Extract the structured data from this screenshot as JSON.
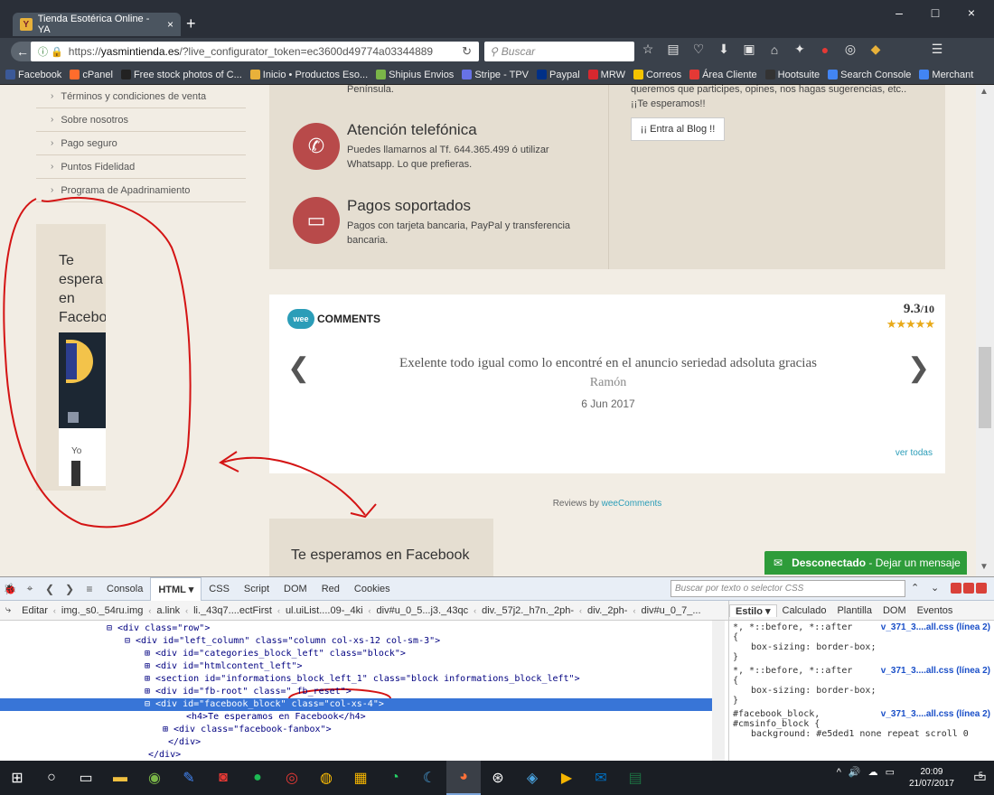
{
  "browser": {
    "tab_title": "Tienda Esotérica Online - YA",
    "tab_close": "×",
    "new_tab": "+",
    "url_prefix": "https://",
    "url_domain": "yasmintienda.es",
    "url_rest": "/?live_configurator_token=ec3600d49774a03344889",
    "search_placeholder": "Buscar",
    "minimize": "–",
    "maximize": "□",
    "close": "×",
    "bookmarks": [
      {
        "label": "Facebook",
        "color": "#3b5998"
      },
      {
        "label": "cPanel",
        "color": "#ff6c2c"
      },
      {
        "label": "Free stock photos of C...",
        "color": "#222"
      },
      {
        "label": "Inicio • Productos Eso...",
        "color": "#e8b13a"
      },
      {
        "label": "Shipius Envios",
        "color": "#7ab648"
      },
      {
        "label": "Stripe - TPV",
        "color": "#6772e5"
      },
      {
        "label": "Paypal",
        "color": "#003087"
      },
      {
        "label": "MRW",
        "color": "#d7282f"
      },
      {
        "label": "Correos",
        "color": "#f5c400"
      },
      {
        "label": "Área Cliente",
        "color": "#e53935"
      },
      {
        "label": "Hootsuite",
        "color": "#333"
      },
      {
        "label": "Search Console",
        "color": "#4285f4"
      },
      {
        "label": "Merchant",
        "color": "#4285f4"
      }
    ]
  },
  "page": {
    "menu_items": [
      "Términos y condiciones de venta",
      "Sobre nosotros",
      "Pago seguro",
      "Puntos Fidelidad",
      "Programa de Apadrinamiento"
    ],
    "fb_title": "Te\nespera\nen\nFacebo",
    "fb_yo": "Yo",
    "peninsula": "Península.",
    "phone_title": "Atención telefónica",
    "phone_text": "Puedes llamarnos al Tf. 644.365.499 ó utilizar Whatsapp. Lo que prefieras.",
    "pay_title": "Pagos soportados",
    "pay_text": "Pagos con tarjeta bancaria, PayPal y transferencia bancaria.",
    "blog_text": "queremos que participes, opines, nos hagas sugerencias, etc.. ¡¡Te esperamos!!",
    "blog_button": "¡¡ Entra al Blog !!",
    "reviews": {
      "brand_wee": "wee",
      "brand_comments": "COMMENTS",
      "score": "9.3",
      "score_max": "/10",
      "stars": "★★★★★",
      "text": "Exelente todo igual como lo encontré en el anuncio seriedad adsoluta gracias",
      "author": "Ramón",
      "date": "6 Jun 2017",
      "see_all": "ver todas",
      "prev": "❮",
      "next": "❯"
    },
    "reviews_by_prefix": "Reviews by ",
    "reviews_by_brand": "weeComments",
    "fb_bottom_title": "Te esperamos en Facebook",
    "chat_status": "Desconectado",
    "chat_action": " - Dejar un mensaje"
  },
  "devtools": {
    "tabs": [
      "Consola",
      "HTML ▾",
      "CSS",
      "Script",
      "DOM",
      "Red",
      "Cookies"
    ],
    "search_placeholder": "Buscar por texto o selector CSS",
    "edit_label": "Editar",
    "breadcrumbs": [
      "img._s0._54ru.img",
      "a.link",
      "li._43q7....ectFirst",
      "ul.uiList....09-_4ki",
      "div#u_0_5...j3._43qc",
      "div._57j2._h7n._2ph-",
      "div._2ph-",
      "div#u_0_7_..."
    ],
    "html_lines": [
      {
        "indent": 118,
        "expander": "⊟",
        "text": "<div class=\"row\">"
      },
      {
        "indent": 138,
        "expander": "⊟",
        "text": "<div id=\"left_column\" class=\"column col-xs-12 col-sm-3\">"
      },
      {
        "indent": 160,
        "expander": "⊞",
        "text": "<div id=\"categories_block_left\" class=\"block\">"
      },
      {
        "indent": 160,
        "expander": "⊞",
        "text": "<div id=\"htmlcontent_left\">"
      },
      {
        "indent": 160,
        "expander": "⊞",
        "text": "<section id=\"informations_block_left_1\" class=\"block informations_block_left\">"
      },
      {
        "indent": 160,
        "expander": "⊞",
        "text": "<div id=\"fb-root\" class=\" fb_reset\">"
      },
      {
        "indent": 160,
        "expander": "⊟",
        "text": "<div id=\"facebook_block\" class=\"col-xs-4\">"
      },
      {
        "indent": 194,
        "expander": "",
        "text": "<h4>Te esperamos en Facebook</h4>"
      },
      {
        "indent": 180,
        "expander": "⊞",
        "text": "<div class=\"facebook-fanbox\">"
      },
      {
        "indent": 174,
        "expander": "",
        "text": "</div>"
      },
      {
        "indent": 152,
        "expander": "",
        "text": "</div>"
      }
    ],
    "style_tabs": [
      "Estilo ▾",
      "Calculado",
      "Plantilla",
      "DOM",
      "Eventos"
    ],
    "css_rules": [
      {
        "selector": "*, *::before, *::after",
        "source": "v_371_3....all.css (línea 2)",
        "open": "{",
        "prop": "box-sizing: border-box;",
        "close": "}"
      },
      {
        "selector": "*, *::before, *::after",
        "source": "v_371_3....all.css (línea 2)",
        "open": "{",
        "prop": "box-sizing: border-box;",
        "close": "}"
      },
      {
        "selector": "#facebook_block,",
        "source": "v_371_3....all.css (línea 2)",
        "open": "#cmsinfo_block {",
        "prop": "background: #e5ded1 none repeat scroll 0",
        "close": ""
      }
    ]
  },
  "taskbar": {
    "time": "20:09",
    "date": "21/07/2017",
    "notifications": "5"
  },
  "colors": {
    "accent_red": "#b84a4a",
    "chat_green": "#2e9c3a",
    "annotation_red": "#d41414",
    "devtools_selection": "#3875d7"
  }
}
